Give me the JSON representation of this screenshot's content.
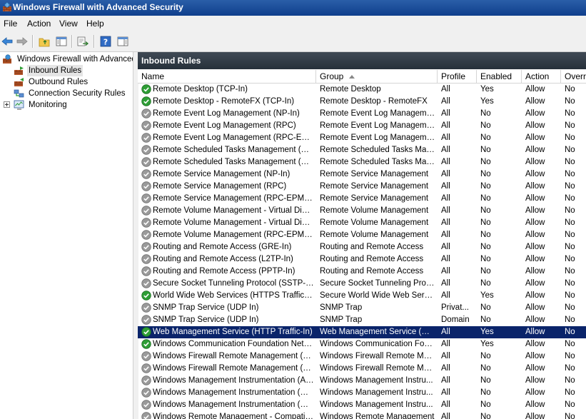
{
  "window": {
    "title": "Windows Firewall with Advanced Security"
  },
  "menu": [
    "File",
    "Action",
    "View",
    "Help"
  ],
  "tree": [
    {
      "label": "Windows Firewall with Advanced Security",
      "icon": "firewall-icon",
      "level": 0,
      "expander": ""
    },
    {
      "label": "Inbound Rules",
      "icon": "inbound-rules-icon",
      "level": 1,
      "selected": true
    },
    {
      "label": "Outbound Rules",
      "icon": "outbound-rules-icon",
      "level": 1
    },
    {
      "label": "Connection Security Rules",
      "icon": "connection-security-icon",
      "level": 1
    },
    {
      "label": "Monitoring",
      "icon": "monitoring-icon",
      "level": 1,
      "expander": "+"
    }
  ],
  "pane": {
    "title": "Inbound Rules"
  },
  "columns": [
    "Name",
    "Group",
    "Profile",
    "Enabled",
    "Action",
    "Override"
  ],
  "rules": [
    {
      "name": "Remote Desktop (TCP-In)",
      "group": "Remote Desktop",
      "profile": "All",
      "enabled": "Yes",
      "action": "Allow",
      "override": "No"
    },
    {
      "name": "Remote Desktop - RemoteFX (TCP-In)",
      "group": "Remote Desktop - RemoteFX",
      "profile": "All",
      "enabled": "Yes",
      "action": "Allow",
      "override": "No"
    },
    {
      "name": "Remote Event Log Management (NP-In)",
      "group": "Remote Event Log Management",
      "profile": "All",
      "enabled": "No",
      "action": "Allow",
      "override": "No"
    },
    {
      "name": "Remote Event Log Management (RPC)",
      "group": "Remote Event Log Management",
      "profile": "All",
      "enabled": "No",
      "action": "Allow",
      "override": "No"
    },
    {
      "name": "Remote Event Log Management (RPC-EPMAP)",
      "group": "Remote Event Log Management",
      "profile": "All",
      "enabled": "No",
      "action": "Allow",
      "override": "No"
    },
    {
      "name": "Remote Scheduled Tasks Management (RPC)",
      "group": "Remote Scheduled Tasks Man...",
      "profile": "All",
      "enabled": "No",
      "action": "Allow",
      "override": "No"
    },
    {
      "name": "Remote Scheduled Tasks Management (RPC...",
      "group": "Remote Scheduled Tasks Man...",
      "profile": "All",
      "enabled": "No",
      "action": "Allow",
      "override": "No"
    },
    {
      "name": "Remote Service Management (NP-In)",
      "group": "Remote Service Management",
      "profile": "All",
      "enabled": "No",
      "action": "Allow",
      "override": "No"
    },
    {
      "name": "Remote Service Management (RPC)",
      "group": "Remote Service Management",
      "profile": "All",
      "enabled": "No",
      "action": "Allow",
      "override": "No"
    },
    {
      "name": "Remote Service Management (RPC-EPMAP)",
      "group": "Remote Service Management",
      "profile": "All",
      "enabled": "No",
      "action": "Allow",
      "override": "No"
    },
    {
      "name": "Remote Volume Management - Virtual Disk S...",
      "group": "Remote Volume Management",
      "profile": "All",
      "enabled": "No",
      "action": "Allow",
      "override": "No"
    },
    {
      "name": "Remote Volume Management - Virtual Disk S...",
      "group": "Remote Volume Management",
      "profile": "All",
      "enabled": "No",
      "action": "Allow",
      "override": "No"
    },
    {
      "name": "Remote Volume Management (RPC-EPMAP)",
      "group": "Remote Volume Management",
      "profile": "All",
      "enabled": "No",
      "action": "Allow",
      "override": "No"
    },
    {
      "name": "Routing and Remote Access (GRE-In)",
      "group": "Routing and Remote Access",
      "profile": "All",
      "enabled": "No",
      "action": "Allow",
      "override": "No"
    },
    {
      "name": "Routing and Remote Access (L2TP-In)",
      "group": "Routing and Remote Access",
      "profile": "All",
      "enabled": "No",
      "action": "Allow",
      "override": "No"
    },
    {
      "name": "Routing and Remote Access (PPTP-In)",
      "group": "Routing and Remote Access",
      "profile": "All",
      "enabled": "No",
      "action": "Allow",
      "override": "No"
    },
    {
      "name": "Secure Socket Tunneling Protocol (SSTP-In)",
      "group": "Secure Socket Tunneling Proto...",
      "profile": "All",
      "enabled": "No",
      "action": "Allow",
      "override": "No"
    },
    {
      "name": "World Wide Web Services (HTTPS Traffic-In)",
      "group": "Secure World Wide Web Servi...",
      "profile": "All",
      "enabled": "Yes",
      "action": "Allow",
      "override": "No"
    },
    {
      "name": "SNMP Trap Service (UDP In)",
      "group": "SNMP Trap",
      "profile": "Privat...",
      "enabled": "No",
      "action": "Allow",
      "override": "No"
    },
    {
      "name": "SNMP Trap Service (UDP In)",
      "group": "SNMP Trap",
      "profile": "Domain",
      "enabled": "No",
      "action": "Allow",
      "override": "No"
    },
    {
      "name": "Web Management Service (HTTP Traffic-In)",
      "group": "Web Management Service (HT...",
      "profile": "All",
      "enabled": "Yes",
      "action": "Allow",
      "override": "No",
      "selected": true
    },
    {
      "name": "Windows Communication Foundation Net.TC...",
      "group": "Windows Communication Foun...",
      "profile": "All",
      "enabled": "Yes",
      "action": "Allow",
      "override": "No"
    },
    {
      "name": "Windows Firewall Remote Management (RPC)",
      "group": "Windows Firewall Remote Man...",
      "profile": "All",
      "enabled": "No",
      "action": "Allow",
      "override": "No"
    },
    {
      "name": "Windows Firewall Remote Management (RPC...",
      "group": "Windows Firewall Remote Man...",
      "profile": "All",
      "enabled": "No",
      "action": "Allow",
      "override": "No"
    },
    {
      "name": "Windows Management Instrumentation (ASy...",
      "group": "Windows Management Instru...",
      "profile": "All",
      "enabled": "No",
      "action": "Allow",
      "override": "No"
    },
    {
      "name": "Windows Management Instrumentation (DC...",
      "group": "Windows Management Instru...",
      "profile": "All",
      "enabled": "No",
      "action": "Allow",
      "override": "No"
    },
    {
      "name": "Windows Management Instrumentation (WM...",
      "group": "Windows Management Instru...",
      "profile": "All",
      "enabled": "No",
      "action": "Allow",
      "override": "No"
    },
    {
      "name": "Windows Remote Management - Compatibilit...",
      "group": "Windows Remote Management",
      "profile": "All",
      "enabled": "No",
      "action": "Allow",
      "override": "No"
    }
  ],
  "colors": {
    "accent": "#0a246a",
    "enabled_icon": "#2e9e35",
    "disabled_icon": "#9a9a9a"
  }
}
